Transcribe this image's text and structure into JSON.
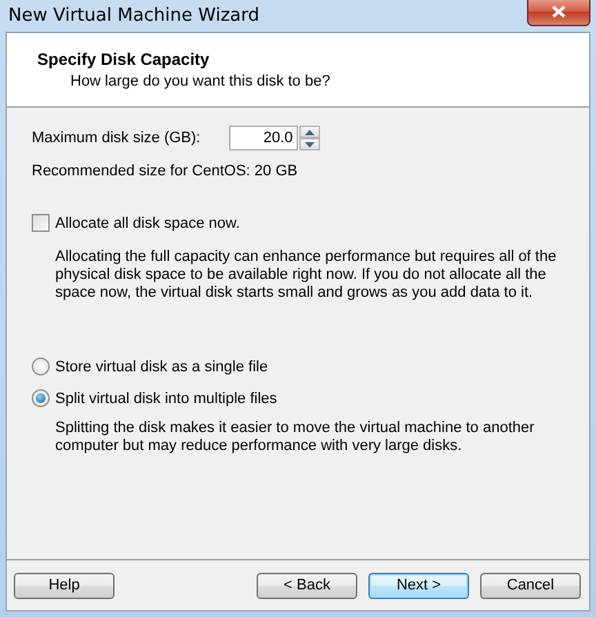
{
  "window": {
    "title": "New Virtual Machine Wizard"
  },
  "header": {
    "title": "Specify Disk Capacity",
    "subtitle": "How large do you want this disk to be?"
  },
  "disk_size": {
    "label": "Maximum disk size (GB):",
    "value": "20.0"
  },
  "recommendation": "Recommended size for CentOS: 20 GB",
  "allocate": {
    "label": "Allocate all disk space now.",
    "checked": false,
    "description": "Allocating the full capacity can enhance performance but requires all of the physical disk space to be available right now. If you do not allocate all the space now, the virtual disk starts small and grows as you add data to it."
  },
  "storage_options": [
    {
      "label": "Store virtual disk as a single file",
      "selected": false
    },
    {
      "label": "Split virtual disk into multiple files",
      "selected": true,
      "description": "Splitting the disk makes it easier to move the virtual machine to another computer but may reduce performance with very large disks."
    }
  ],
  "buttons": [
    {
      "label": "Help",
      "kind": "help"
    },
    {
      "label": "< Back",
      "kind": "nav"
    },
    {
      "label": "Next >",
      "kind": "default"
    },
    {
      "label": "Cancel",
      "kind": "nav"
    }
  ]
}
